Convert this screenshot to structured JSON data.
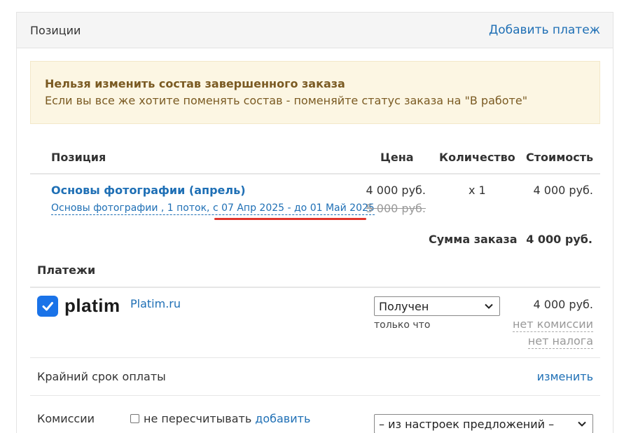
{
  "header": {
    "title": "Позиции",
    "add_payment": "Добавить платеж"
  },
  "alert": {
    "title": "Нельзя изменить состав завершенного заказа",
    "text": "Если вы все же хотите поменять состав - поменяйте статус заказа на \"В работе\""
  },
  "table": {
    "columns": {
      "position": "Позиция",
      "price": "Цена",
      "quantity": "Количество",
      "cost": "Стоимость"
    },
    "item": {
      "title": "Основы фотографии (апрель)",
      "subtitle": "Основы фотографии , 1 поток, с 07 Апр 2025 - до 01 Май 2025",
      "price": "4 000 руб.",
      "old_price": "5 000 руб.",
      "quantity": "x 1",
      "cost": "4 000 руб."
    },
    "total_label": "Сумма заказа",
    "total_value": "4 000 руб."
  },
  "payments": {
    "title": "Платежи",
    "logo_text": "platim",
    "provider_link": "Platim.ru",
    "status": "Получен",
    "time": "только что",
    "amount": "4 000 руб.",
    "fee": "нет комиссии",
    "tax": "нет налога"
  },
  "deadline": {
    "label": "Крайний срок оплаты",
    "change": "изменить"
  },
  "fees": {
    "label": "Комиссии",
    "checkbox_label": "не пересчитывать",
    "add": "добавить",
    "select_value": "– из настроек предложений –"
  },
  "colors": {
    "link": "#1e6fb5",
    "alert_bg": "#fcf6e3",
    "alert_text": "#7a5a22",
    "highlight": "#e0342b",
    "logo": "#1a73e8"
  },
  "icons": [
    "checkmark-icon",
    "chevron-down-icon",
    "checkbox-icon"
  ]
}
